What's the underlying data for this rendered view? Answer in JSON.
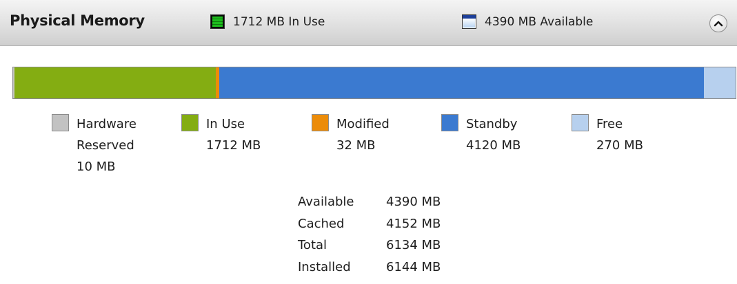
{
  "section": {
    "title": "Physical Memory",
    "header_in_use": "1712 MB In Use",
    "header_available": "4390 MB Available"
  },
  "colors": {
    "hardware_reserved": "#c2c2c2",
    "in_use": "#84ad12",
    "modified": "#ec8c09",
    "standby": "#3b7ad0",
    "free": "#b7d0ee"
  },
  "legend": [
    {
      "key": "hardware_reserved",
      "line1": "Hardware",
      "line2": "Reserved",
      "line3": "10 MB",
      "mb": 10
    },
    {
      "key": "in_use",
      "line1": "In Use",
      "line2": "1712 MB",
      "mb": 1712
    },
    {
      "key": "modified",
      "line1": "Modified",
      "line2": "32 MB",
      "mb": 32
    },
    {
      "key": "standby",
      "line1": "Standby",
      "line2": "4120 MB",
      "mb": 4120
    },
    {
      "key": "free",
      "line1": "Free",
      "line2": "270 MB",
      "mb": 270
    }
  ],
  "stats": [
    {
      "label": "Available",
      "value": "4390 MB"
    },
    {
      "label": "Cached",
      "value": "4152 MB"
    },
    {
      "label": "Total",
      "value": "6134 MB"
    },
    {
      "label": "Installed",
      "value": "6144 MB"
    }
  ],
  "icons": {
    "collapse": "chevron-up-icon",
    "in_use_indicator": "memory-in-use-icon",
    "available_indicator": "memory-available-icon"
  }
}
